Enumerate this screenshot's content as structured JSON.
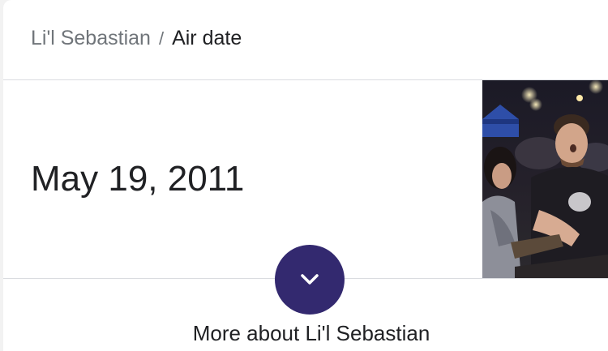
{
  "breadcrumb": {
    "parent": "Li'l Sebastian",
    "separator": "/",
    "current": "Air date"
  },
  "answer": {
    "value": "May 19, 2011"
  },
  "thumbnail": {
    "description_icon": "photo-thumbnail"
  },
  "expand": {
    "icon": "chevron-down-icon",
    "color": "#33296f"
  },
  "more": {
    "label": "More about Li'l Sebastian"
  }
}
